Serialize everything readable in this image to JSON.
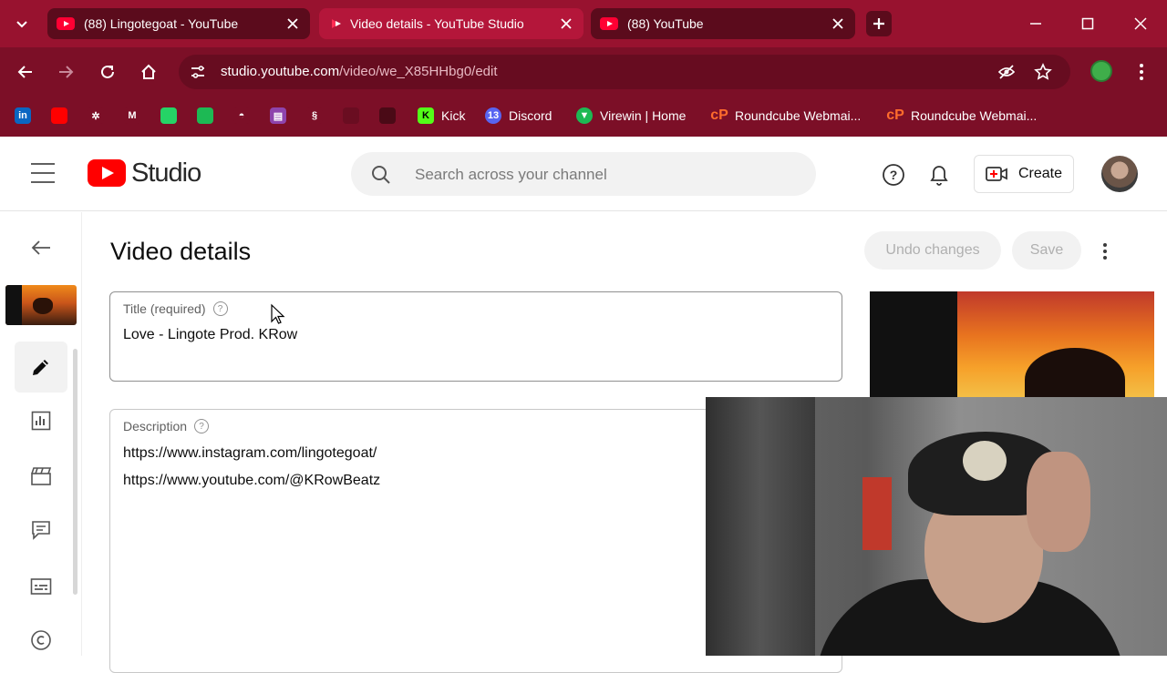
{
  "browser": {
    "tabs": [
      {
        "title": "(88) Lingotegoat - YouTube",
        "active": false
      },
      {
        "title": "Video details - YouTube Studio",
        "active": true
      },
      {
        "title": "(88) YouTube",
        "active": false
      }
    ],
    "url_host": "studio.youtube.com",
    "url_path": "/video/we_X85HHbg0/edit",
    "bookmarks": [
      {
        "label": "Kick",
        "icon": "kick-icon",
        "color": "#53fc18"
      },
      {
        "label": "Discord",
        "icon": "discord-icon",
        "color": "#5865f2"
      },
      {
        "label": "Virewin | Home",
        "icon": "virewin-icon",
        "color": "#1db954"
      },
      {
        "label": "Roundcube Webmai...",
        "icon": "cpanel-icon",
        "color": "#ff6c2c"
      },
      {
        "label": "Roundcube Webmai...",
        "icon": "cpanel-icon",
        "color": "#ff6c2c"
      }
    ],
    "bookmark_icons": [
      {
        "icon": "linkedin-icon",
        "color": "#0a66c2",
        "glyph": "in"
      },
      {
        "icon": "youtube-icon",
        "color": "#ff0000",
        "glyph": ""
      },
      {
        "icon": "grid-app-icon",
        "color": "#7c0f27",
        "glyph": "✲"
      },
      {
        "icon": "gmail-icon",
        "color": "#7c0f27",
        "glyph": "M"
      },
      {
        "icon": "whatsapp-icon",
        "color": "#25d366",
        "glyph": ""
      },
      {
        "icon": "spotify-icon",
        "color": "#1db954",
        "glyph": ""
      },
      {
        "icon": "app-icon",
        "color": "#7c0f27",
        "glyph": "◓"
      },
      {
        "icon": "film-icon",
        "color": "#8e44ad",
        "glyph": "▤"
      },
      {
        "icon": "app-icon",
        "color": "#7c0f27",
        "glyph": "§"
      },
      {
        "icon": "app-icon",
        "color": "#6a0d21",
        "glyph": ""
      },
      {
        "icon": "app-icon",
        "color": "#4a0a16",
        "glyph": ""
      }
    ]
  },
  "studio": {
    "logo_text": "Studio",
    "search_placeholder": "Search across your channel",
    "create_label": "Create"
  },
  "page": {
    "title": "Video details",
    "undo_label": "Undo changes",
    "save_label": "Save",
    "title_field": {
      "label": "Title (required)",
      "help": "?",
      "value": "Love - Lingote Prod. KRow"
    },
    "description_field": {
      "label": "Description",
      "help": "?",
      "lines": [
        "https://www.instagram.com/lingotegoat/",
        "https://www.youtube.com/@KRowBeatz"
      ]
    }
  },
  "colors": {
    "tabbar": "#98122f",
    "toolbar": "#7c0f27",
    "accent": "#ff0000"
  }
}
